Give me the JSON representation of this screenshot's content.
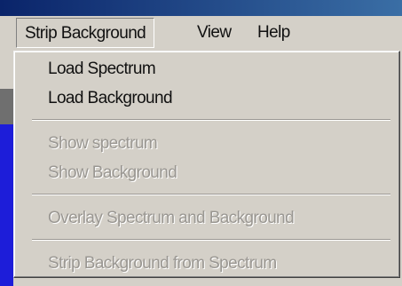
{
  "menubar": {
    "items": [
      {
        "label": "Strip Background",
        "active": true
      },
      {
        "label": "View"
      },
      {
        "label": "Help"
      }
    ]
  },
  "dropdown": {
    "items": [
      {
        "label": "Load Spectrum",
        "enabled": true
      },
      {
        "label": "Load Background",
        "enabled": true
      },
      {
        "label": "Show spectrum",
        "enabled": false
      },
      {
        "label": "Show Background",
        "enabled": false
      },
      {
        "label": "Overlay Spectrum and Background",
        "enabled": false
      },
      {
        "label": "Strip Background from Spectrum",
        "enabled": false
      }
    ]
  },
  "colors": {
    "menu_background": "#d4d0c8",
    "disabled_text": "#9a9792",
    "blue_client_area": "#1d1dd9"
  }
}
